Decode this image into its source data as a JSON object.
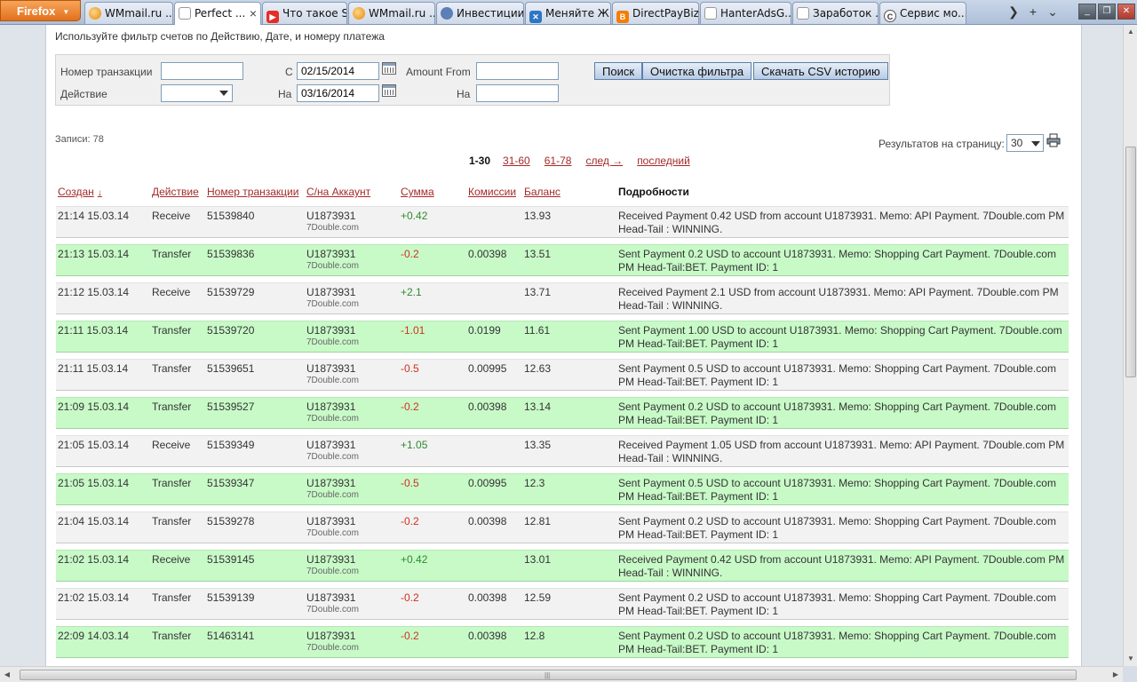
{
  "browser": {
    "menu_button": "Firefox",
    "tabs": [
      {
        "label": "WMmail.ru ...",
        "icon": "wmmail-favicon"
      },
      {
        "label": "Perfect ...",
        "icon": "blank-page-favicon",
        "active": true
      },
      {
        "label": "Что такое S...",
        "icon": "youtube-favicon"
      },
      {
        "label": "WMmail.ru ...",
        "icon": "wmmail-favicon"
      },
      {
        "label": "Инвестиции",
        "icon": "person-favicon"
      },
      {
        "label": "Меняйте Ж...",
        "icon": "x-favicon"
      },
      {
        "label": "DirectPayBiz",
        "icon": "blogger-favicon"
      },
      {
        "label": "HanterAdsG...",
        "icon": "blank-page-favicon"
      },
      {
        "label": "Заработок ...",
        "icon": "blank-page-favicon"
      },
      {
        "label": "Сервис мо...",
        "icon": "c-favicon"
      }
    ]
  },
  "filter": {
    "title": "Используйте фильтр счетов по Действию, Дате, и номеру платежа",
    "labels": {
      "transaction_number": "Номер транзакции",
      "action": "Действие",
      "from": "С",
      "to": "На",
      "amount_from": "Amount From",
      "amount_to": "На"
    },
    "values": {
      "transaction_number": "",
      "action": "",
      "date_from": "02/15/2014",
      "date_to": "03/16/2014",
      "amount_from": "",
      "amount_to": ""
    },
    "buttons": {
      "search": "Поиск",
      "clear": "Очистка фильтра",
      "csv": "Скачать CSV историю"
    }
  },
  "summary": {
    "records": "Записи: 78",
    "per_page_label": "Результатов на страницу:",
    "per_page_value": "30"
  },
  "pager": {
    "current": "1-30",
    "pages": [
      "31-60",
      "61-78"
    ],
    "next": "след →",
    "last": "последний"
  },
  "columns": {
    "created": "Создан",
    "created_sort": "↓",
    "action": "Действие",
    "txn": "Номер транзакции",
    "account": "С/на Аккаунт",
    "amount": "Сумма",
    "fee": "Комиссии",
    "balance": "Баланс",
    "details": "Подробности"
  },
  "transactions": [
    {
      "created": "21:14 15.03.14",
      "action": "Receive",
      "txn": "51539840",
      "account": "U1873931",
      "account_name": "7Double.com",
      "amount": "+0.42",
      "fee": "",
      "balance": "13.93",
      "details": "Received Payment 0.42 USD from account U1873931. Memo: API Payment. 7Double.com PM Head-Tail : WINNING.",
      "highlight": false
    },
    {
      "created": "21:13 15.03.14",
      "action": "Transfer",
      "txn": "51539836",
      "account": "U1873931",
      "account_name": "7Double.com",
      "amount": "-0.2",
      "fee": "0.00398",
      "balance": "13.51",
      "details": "Sent Payment 0.2 USD to account U1873931. Memo: Shopping Cart Payment. 7Double.com PM Head-Tail:BET. Payment ID: 1",
      "highlight": true
    },
    {
      "created": "21:12 15.03.14",
      "action": "Receive",
      "txn": "51539729",
      "account": "U1873931",
      "account_name": "7Double.com",
      "amount": "+2.1",
      "fee": "",
      "balance": "13.71",
      "details": "Received Payment 2.1 USD from account U1873931. Memo: API Payment. 7Double.com PM Head-Tail : WINNING.",
      "highlight": false
    },
    {
      "created": "21:11 15.03.14",
      "action": "Transfer",
      "txn": "51539720",
      "account": "U1873931",
      "account_name": "7Double.com",
      "amount": "-1.01",
      "fee": "0.0199",
      "balance": "11.61",
      "details": "Sent Payment 1.00 USD to account U1873931. Memo: Shopping Cart Payment. 7Double.com PM Head-Tail:BET. Payment ID: 1",
      "highlight": true
    },
    {
      "created": "21:11 15.03.14",
      "action": "Transfer",
      "txn": "51539651",
      "account": "U1873931",
      "account_name": "7Double.com",
      "amount": "-0.5",
      "fee": "0.00995",
      "balance": "12.63",
      "details": "Sent Payment 0.5 USD to account U1873931. Memo: Shopping Cart Payment. 7Double.com PM Head-Tail:BET. Payment ID: 1",
      "highlight": false
    },
    {
      "created": "21:09 15.03.14",
      "action": "Transfer",
      "txn": "51539527",
      "account": "U1873931",
      "account_name": "7Double.com",
      "amount": "-0.2",
      "fee": "0.00398",
      "balance": "13.14",
      "details": "Sent Payment 0.2 USD to account U1873931. Memo: Shopping Cart Payment. 7Double.com PM Head-Tail:BET. Payment ID: 1",
      "highlight": true
    },
    {
      "created": "21:05 15.03.14",
      "action": "Receive",
      "txn": "51539349",
      "account": "U1873931",
      "account_name": "7Double.com",
      "amount": "+1.05",
      "fee": "",
      "balance": "13.35",
      "details": "Received Payment 1.05 USD from account U1873931. Memo: API Payment. 7Double.com PM Head-Tail : WINNING.",
      "highlight": false
    },
    {
      "created": "21:05 15.03.14",
      "action": "Transfer",
      "txn": "51539347",
      "account": "U1873931",
      "account_name": "7Double.com",
      "amount": "-0.5",
      "fee": "0.00995",
      "balance": "12.3",
      "details": "Sent Payment 0.5 USD to account U1873931. Memo: Shopping Cart Payment. 7Double.com PM Head-Tail:BET. Payment ID: 1",
      "highlight": true
    },
    {
      "created": "21:04 15.03.14",
      "action": "Transfer",
      "txn": "51539278",
      "account": "U1873931",
      "account_name": "7Double.com",
      "amount": "-0.2",
      "fee": "0.00398",
      "balance": "12.81",
      "details": "Sent Payment 0.2 USD to account U1873931. Memo: Shopping Cart Payment. 7Double.com PM Head-Tail:BET. Payment ID: 1",
      "highlight": false
    },
    {
      "created": "21:02 15.03.14",
      "action": "Receive",
      "txn": "51539145",
      "account": "U1873931",
      "account_name": "7Double.com",
      "amount": "+0.42",
      "fee": "",
      "balance": "13.01",
      "details": "Received Payment 0.42 USD from account U1873931. Memo: API Payment. 7Double.com PM Head-Tail : WINNING.",
      "highlight": true
    },
    {
      "created": "21:02 15.03.14",
      "action": "Transfer",
      "txn": "51539139",
      "account": "U1873931",
      "account_name": "7Double.com",
      "amount": "-0.2",
      "fee": "0.00398",
      "balance": "12.59",
      "details": "Sent Payment 0.2 USD to account U1873931. Memo: Shopping Cart Payment. 7Double.com PM Head-Tail:BET. Payment ID: 1",
      "highlight": false
    },
    {
      "created": "22:09 14.03.14",
      "action": "Transfer",
      "txn": "51463141",
      "account": "U1873931",
      "account_name": "7Double.com",
      "amount": "-0.2",
      "fee": "0.00398",
      "balance": "12.8",
      "details": "Sent Payment 0.2 USD to account U1873931. Memo: Shopping Cart Payment. 7Double.com PM Head-Tail:BET. Payment ID: 1",
      "highlight": true
    }
  ],
  "colors": {
    "row_default": "#f2f2f2",
    "row_highlight": "#c8fac8",
    "amount_positive": "#2e8b2e",
    "amount_negative": "#d0311f",
    "link": "#a52a2a"
  }
}
